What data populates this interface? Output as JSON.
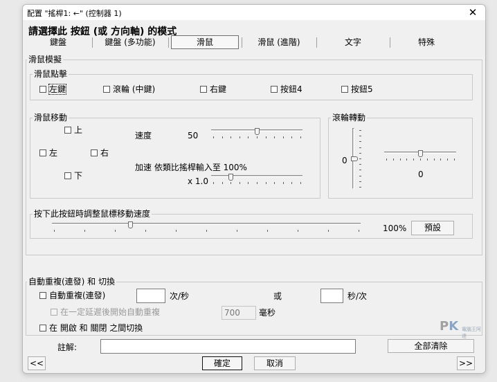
{
  "window": {
    "title": "配置 \"搖桿1: ←\" (控制器 1)",
    "close_glyph": "✕"
  },
  "heading": "請選擇此 按鈕 (或 方向軸) 的模式",
  "tabs": [
    {
      "label": "鍵盤",
      "active": false
    },
    {
      "label": "鍵盤 (多功能)",
      "active": false
    },
    {
      "label": "滑鼠",
      "active": true
    },
    {
      "label": "滑鼠 (進階)",
      "active": false
    },
    {
      "label": "文字",
      "active": false
    },
    {
      "label": "特殊",
      "active": false
    }
  ],
  "mouse_sim": {
    "group_label": "滑鼠模擬",
    "click": {
      "label": "滑鼠點擊",
      "options": [
        {
          "label": "左鍵",
          "checked": false,
          "focused": true
        },
        {
          "label": "滾輪 (中鍵)",
          "checked": false
        },
        {
          "label": "右鍵",
          "checked": false
        },
        {
          "label": "按鈕4",
          "checked": false
        },
        {
          "label": "按鈕5",
          "checked": false
        }
      ]
    },
    "movement": {
      "label": "滑鼠移動",
      "up": "上",
      "left": "左",
      "right": "右",
      "down": "下",
      "speed_label": "速度",
      "speed_value": "50",
      "speed_fraction": 0.5,
      "accel_label": "加速 依類比搖桿輸入至 100%",
      "accel_value": "x 1.0",
      "accel_fraction": 0.2
    },
    "wheel": {
      "label": "滾輪轉動",
      "vertical_value": "0",
      "horizontal_value": "0",
      "vertical_fraction": 0.5,
      "horizontal_fraction": 0.5
    },
    "press_speed": {
      "label": "按下此按鈕時調整鼠標移動速度",
      "value": "100%",
      "fraction": 0.25,
      "default_button": "預設"
    }
  },
  "auto_repeat": {
    "group_label": "自動重複(連發) 和 切換",
    "enable_label": "自動重複(連發)",
    "rate_value": "",
    "rate_unit": "次/秒",
    "or_label": "或",
    "interval_value": "",
    "interval_unit": "秒/次",
    "delay_label": "在一定延遲後開始自動重複",
    "delay_value": "700",
    "delay_unit": "毫秒",
    "toggle_label": "在 開啟 和 關閉 之間切換"
  },
  "footer": {
    "comment_label": "註解:",
    "comment_value": "",
    "clear_all": "全部清除",
    "prev": "<<",
    "next": ">>",
    "ok": "確定",
    "cancel": "取消"
  },
  "watermark": {
    "text_p": "P",
    "text_k": "K",
    "sub": "電腦王阿達"
  },
  "colors": {
    "dialog_bg": "#f0f0f0",
    "border": "#adadad",
    "disabled_text": "#9a9a9a"
  }
}
